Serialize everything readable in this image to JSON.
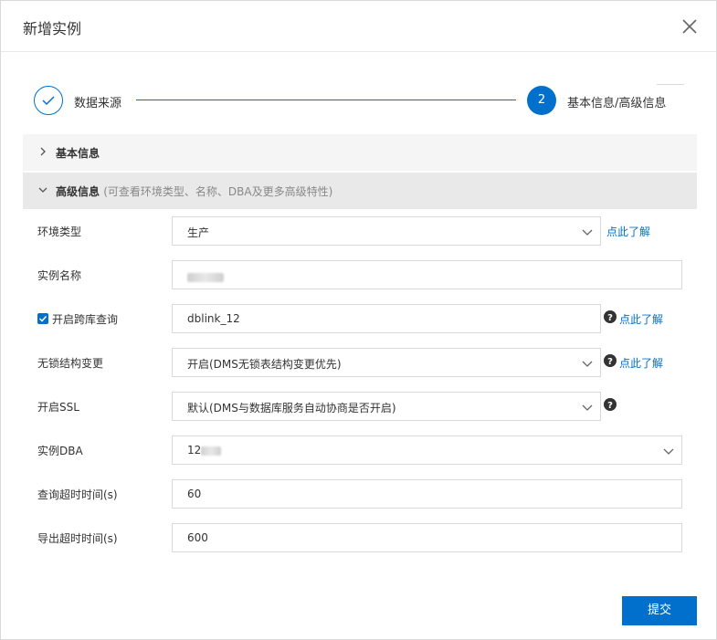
{
  "dialog": {
    "title": "新增实例"
  },
  "steps": [
    {
      "label": "数据来源",
      "state": "done"
    },
    {
      "number": "2",
      "label": "基本信息/高级信息",
      "state": "active"
    }
  ],
  "panels": {
    "basic": {
      "title": "基本信息"
    },
    "advanced": {
      "title": "高级信息",
      "subtitle": "(可查看环境类型、名称、DBA及更多高级特性)"
    }
  },
  "form": {
    "env_type": {
      "label": "环境类型",
      "value": "生产",
      "link": "点此了解"
    },
    "instance_name": {
      "label": "实例名称",
      "value": ""
    },
    "cross_db": {
      "label": "开启跨库查询",
      "checked": true,
      "value": "dblink_12",
      "link": "点此了解"
    },
    "lockless": {
      "label": "无锁结构变更",
      "value": "开启(DMS无锁表结构变更优先)",
      "link": "点此了解"
    },
    "ssl": {
      "label": "开启SSL",
      "value": "默认(DMS与数据库服务自动协商是否开启)"
    },
    "dba": {
      "label": "实例DBA",
      "value": "12"
    },
    "query_timeout": {
      "label": "查询超时时间(s)",
      "value": "60"
    },
    "export_timeout": {
      "label": "导出超时时间(s)",
      "value": "600"
    }
  },
  "footer": {
    "submit_label": "提交"
  },
  "colors": {
    "primary": "#0070cc",
    "border": "#d9d9d9"
  }
}
